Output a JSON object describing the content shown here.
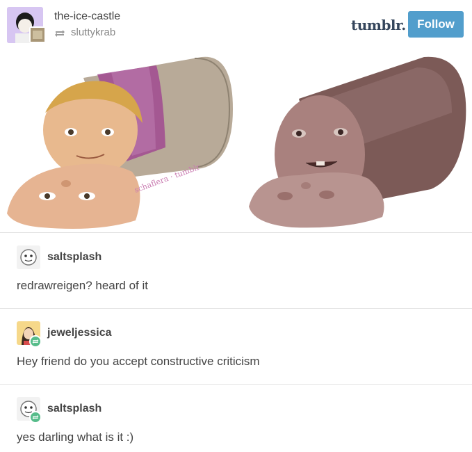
{
  "header": {
    "blog_name": "the-ice-castle",
    "reblogged_from": "sluttykrab",
    "logo": "tumblr.",
    "follow_label": "Follow"
  },
  "artwork": {
    "watermark": "schaflera · tumblr"
  },
  "comments": [
    {
      "username": "saltsplash",
      "text": "redrawreigen? heard of it",
      "reblog_badge": false
    },
    {
      "username": "jeweljessica",
      "text": "Hey friend do you accept constructive criticism",
      "reblog_badge": true
    },
    {
      "username": "saltsplash",
      "text": "yes darling what is it :)",
      "reblog_badge": true
    }
  ],
  "colors": {
    "follow_button": "#529ecc",
    "logo": "#35465c",
    "reblog_badge": "#56bc8a"
  },
  "icons": [
    "reblog-icon",
    "avatar",
    "reblog-badge-icon"
  ]
}
